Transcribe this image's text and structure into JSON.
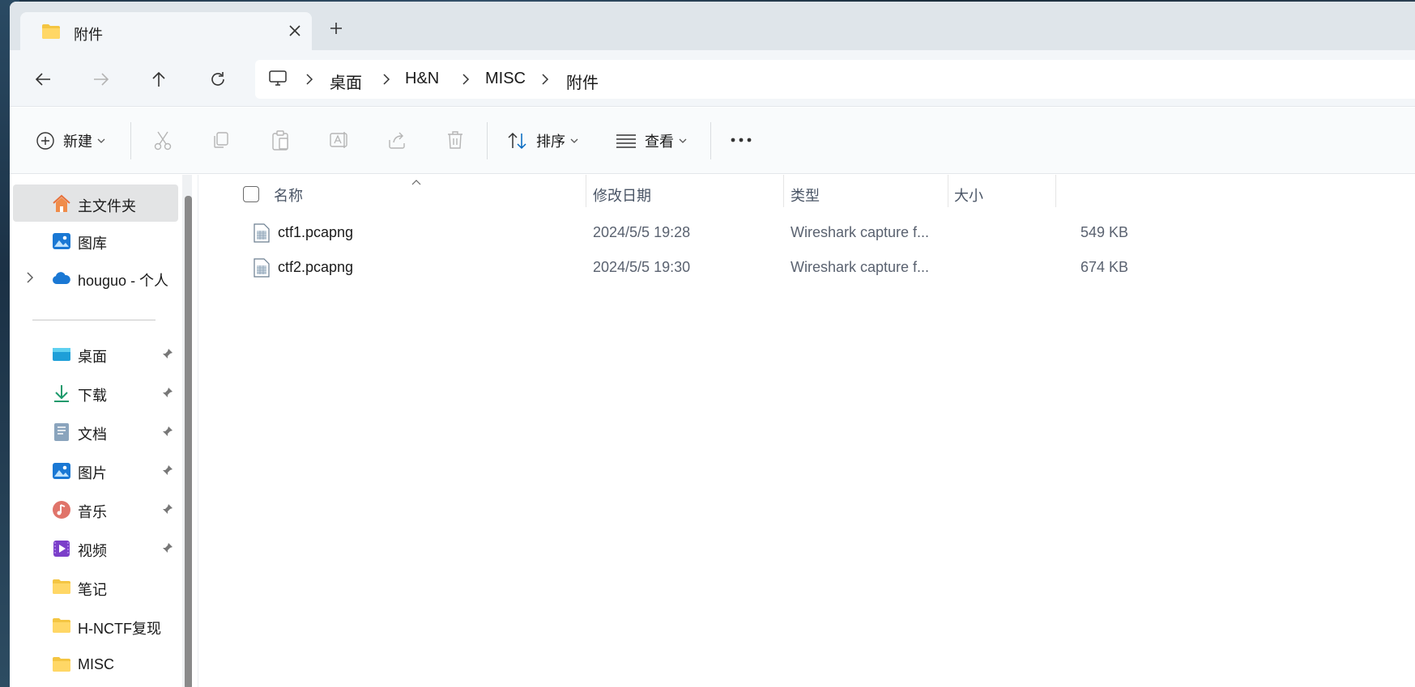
{
  "window": {
    "tab_title": "附件"
  },
  "breadcrumb": {
    "items": [
      "桌面",
      "H&N",
      "MISC",
      "附件"
    ]
  },
  "commandbar": {
    "new_label": "新建",
    "sort_label": "排序",
    "view_label": "查看"
  },
  "sidebar": {
    "top_items": [
      {
        "label": "主文件夹",
        "icon": "home-icon",
        "selected": true
      },
      {
        "label": "图库",
        "icon": "gallery-icon"
      },
      {
        "label": "houguo - 个人",
        "icon": "onedrive-cloud-icon"
      }
    ],
    "quick_access": [
      {
        "label": "桌面",
        "icon": "desktop-icon",
        "pinned": true
      },
      {
        "label": "下载",
        "icon": "download-icon",
        "pinned": true
      },
      {
        "label": "文档",
        "icon": "document-icon",
        "pinned": true
      },
      {
        "label": "图片",
        "icon": "pictures-icon",
        "pinned": true
      },
      {
        "label": "音乐",
        "icon": "music-icon",
        "pinned": true
      },
      {
        "label": "视频",
        "icon": "video-icon",
        "pinned": true
      },
      {
        "label": "笔记",
        "icon": "folder-icon",
        "pinned": false
      },
      {
        "label": "H-NCTF复现",
        "icon": "folder-icon",
        "pinned": false
      },
      {
        "label": "MISC",
        "icon": "folder-icon",
        "pinned": false
      }
    ]
  },
  "filelist": {
    "columns": {
      "name": "名称",
      "modified": "修改日期",
      "type": "类型",
      "size": "大小"
    },
    "rows": [
      {
        "name": "ctf1.pcapng",
        "modified": "2024/5/5 19:28",
        "type": "Wireshark capture f...",
        "size": "549 KB"
      },
      {
        "name": "ctf2.pcapng",
        "modified": "2024/5/5 19:30",
        "type": "Wireshark capture f...",
        "size": "674 KB"
      }
    ]
  },
  "colors": {
    "accent": "#0067c0",
    "folder": "#f4c542",
    "tabstrip_bg": "#dfe5ea"
  }
}
